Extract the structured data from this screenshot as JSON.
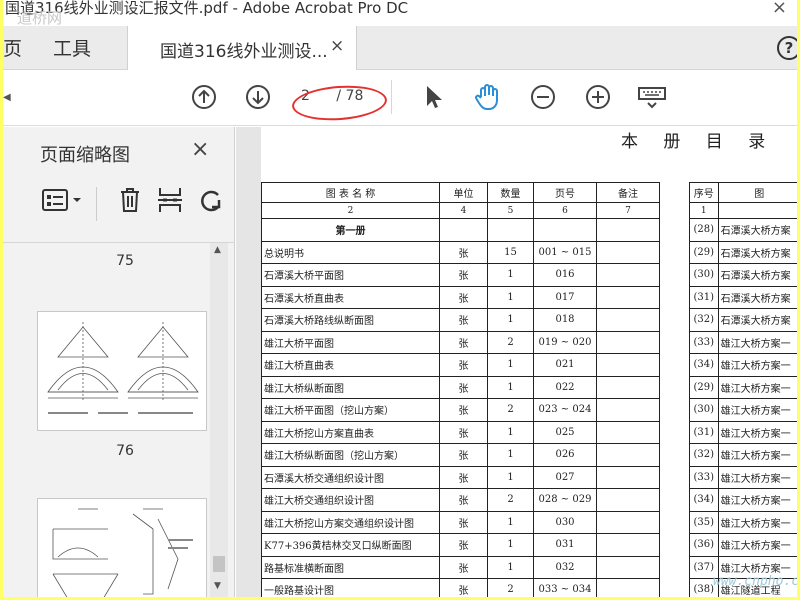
{
  "window": {
    "title": "国道316线外业测设汇报文件.pdf - Adobe Acrobat Pro DC",
    "watermark": "道桥网",
    "close_glyph": "×"
  },
  "tabs": {
    "home_label": "页",
    "tools_label": "工具",
    "doc_label": "国道316线外业测设...",
    "doc_close": "×",
    "help_glyph": "?"
  },
  "toolbar": {
    "current_page": "2",
    "total_pages": "/ 78"
  },
  "panel": {
    "title": "页面缩略图",
    "close_glyph": "×",
    "thumbnails": [
      {
        "number": "75"
      },
      {
        "number": "76"
      }
    ]
  },
  "document": {
    "page_title": "本 册 目 录",
    "table_headers": [
      "图  表  名  称",
      "单位",
      "数量",
      "页号",
      "备注"
    ],
    "table_subheaders": [
      "2",
      "4",
      "5",
      "6",
      "7"
    ],
    "section": "第一册",
    "rows": [
      {
        "name": "总说明书",
        "unit": "张",
        "qty": "15",
        "page": "001 ~ 015"
      },
      {
        "name": "石潭溪大桥平面图",
        "unit": "张",
        "qty": "1",
        "page": "016"
      },
      {
        "name": "石潭溪大桥直曲表",
        "unit": "张",
        "qty": "1",
        "page": "017"
      },
      {
        "name": "石潭溪大桥路线纵断面图",
        "unit": "张",
        "qty": "1",
        "page": "018"
      },
      {
        "name": "雄江大桥平面图",
        "unit": "张",
        "qty": "2",
        "page": "019 ~ 020"
      },
      {
        "name": "雄江大桥直曲表",
        "unit": "张",
        "qty": "1",
        "page": "021"
      },
      {
        "name": "雄江大桥纵断面图",
        "unit": "张",
        "qty": "1",
        "page": "022"
      },
      {
        "name": "雄江大桥平面图（挖山方案）",
        "unit": "张",
        "qty": "2",
        "page": "023 ~ 024"
      },
      {
        "name": "雄江大桥挖山方案直曲表",
        "unit": "张",
        "qty": "1",
        "page": "025"
      },
      {
        "name": "雄江大桥纵断面图（挖山方案）",
        "unit": "张",
        "qty": "1",
        "page": "026"
      },
      {
        "name": "石潭溪大桥交通组织设计图",
        "unit": "张",
        "qty": "1",
        "page": "027"
      },
      {
        "name": "雄江大桥交通组织设计图",
        "unit": "张",
        "qty": "2",
        "page": "028 ~ 029"
      },
      {
        "name": "雄江大桥挖山方案交通组织设计图",
        "unit": "张",
        "qty": "1",
        "page": "030"
      },
      {
        "name": "K77+396黄桔林交叉口纵断面图",
        "unit": "张",
        "qty": "1",
        "page": "031"
      },
      {
        "name": "路基标准横断面图",
        "unit": "张",
        "qty": "1",
        "page": "032"
      },
      {
        "name": "一般路基设计图",
        "unit": "张",
        "qty": "2",
        "page": "033 ~ 034"
      }
    ],
    "table2_headers": [
      "序号",
      "图"
    ],
    "table2_subheaders": [
      "1",
      ""
    ],
    "table2_rows": [
      {
        "no": "(28)",
        "name": "石潭溪大桥方案"
      },
      {
        "no": "(29)",
        "name": "石潭溪大桥方案"
      },
      {
        "no": "(30)",
        "name": "石潭溪大桥方案"
      },
      {
        "no": "(31)",
        "name": "石潭溪大桥方案"
      },
      {
        "no": "(32)",
        "name": "石潭溪大桥方案"
      },
      {
        "no": "(33)",
        "name": "雄江大桥方案一"
      },
      {
        "no": "(34)",
        "name": "雄江大桥方案一"
      },
      {
        "no": "(29)",
        "name": "雄江大桥方案一"
      },
      {
        "no": "(30)",
        "name": "雄江大桥方案一"
      },
      {
        "no": "(31)",
        "name": "雄江大桥方案一"
      },
      {
        "no": "(32)",
        "name": "雄江大桥方案一"
      },
      {
        "no": "(33)",
        "name": "雄江大桥方案一"
      },
      {
        "no": "(34)",
        "name": "雄江大桥方案一"
      },
      {
        "no": "(35)",
        "name": "雄江大桥方案一"
      },
      {
        "no": "(36)",
        "name": "雄江大桥方案一"
      },
      {
        "no": "(37)",
        "name": "雄江大桥方案一"
      },
      {
        "no": "(38)",
        "name": "雄江隧道工程"
      }
    ]
  },
  "site_watermark": "www.cnpho.com",
  "colors": {
    "frame": "#ffff66",
    "annotation": "#e53030",
    "hand_tool": "#2b8fd8"
  }
}
